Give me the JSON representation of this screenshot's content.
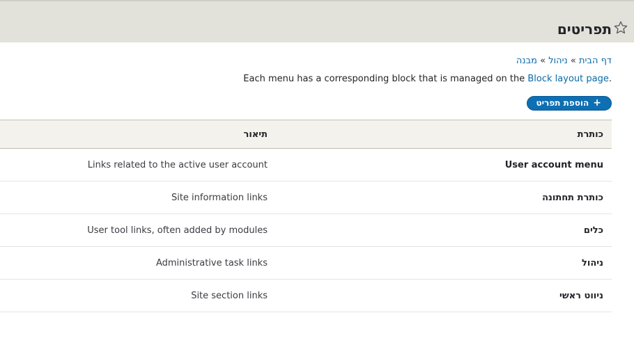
{
  "page": {
    "title": "תפריטים",
    "star_icon": "star-outline-icon"
  },
  "breadcrumb": {
    "items": [
      "דף הבית",
      "ניהול",
      "מבנה"
    ],
    "separator": "»"
  },
  "description": {
    "prefix": "Each menu has a corresponding block that is managed on the",
    "link": "Block layout page",
    "suffix": "."
  },
  "actions": {
    "add_menu_label": "הוספת תפריט",
    "add_icon": "+"
  },
  "table": {
    "headers": {
      "title": "כותרת",
      "description": "תיאור"
    },
    "rows": [
      {
        "title": "User account menu",
        "description": "Links related to the active user account"
      },
      {
        "title": "כותרת תחתונה",
        "description": "Site information links"
      },
      {
        "title": "כלים",
        "description": "User tool links, often added by modules"
      },
      {
        "title": "ניהול",
        "description": "Administrative task links"
      },
      {
        "title": "ניווט ראשי",
        "description": "Site section links"
      }
    ]
  },
  "colors": {
    "header_bg": "#e2e1da",
    "link": "#0a6aa9",
    "primary_button": "#0e6fb3"
  }
}
